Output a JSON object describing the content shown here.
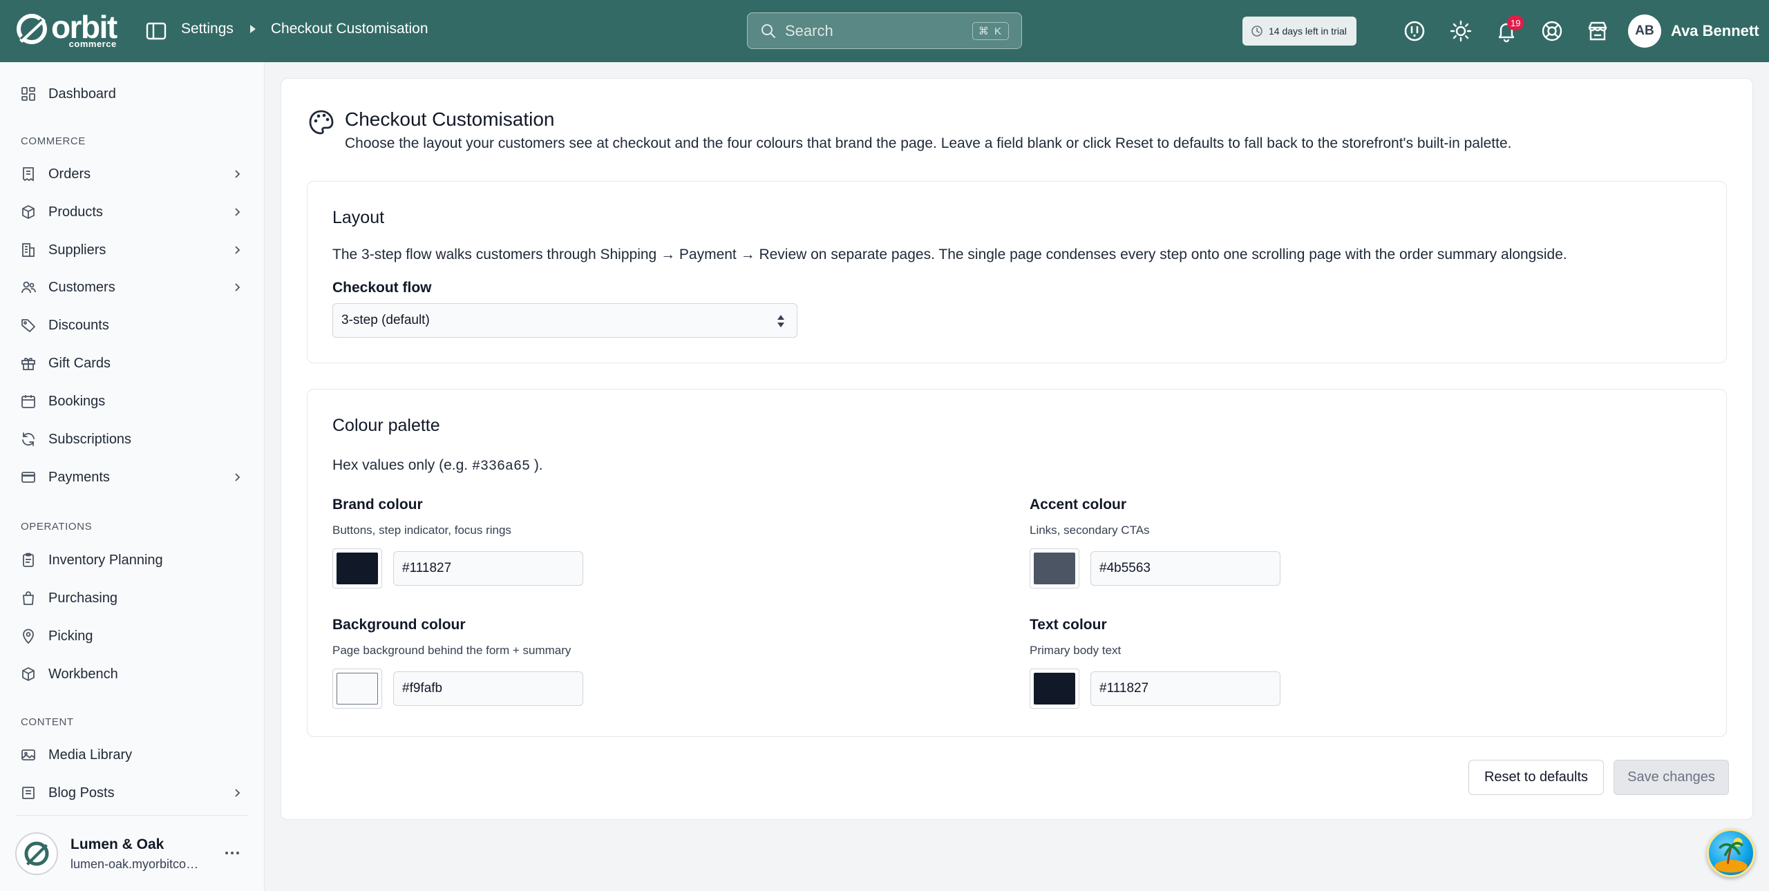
{
  "topbar": {
    "brand_name": "orbit",
    "brand_sub": "commerce",
    "breadcrumb": [
      "Settings",
      "Checkout Customisation"
    ],
    "search_placeholder": "Search",
    "search_shortcut": "⌘ K",
    "trial_text": "14 days left in trial",
    "notification_count": "19",
    "user_initials": "AB",
    "user_name": "Ava Bennett",
    "bar_color": "#336a65"
  },
  "sidebar": {
    "dashboard": "Dashboard",
    "section_commerce": "COMMERCE",
    "orders": "Orders",
    "products": "Products",
    "suppliers": "Suppliers",
    "customers": "Customers",
    "discounts": "Discounts",
    "gift_cards": "Gift Cards",
    "bookings": "Bookings",
    "subscriptions": "Subscriptions",
    "payments": "Payments",
    "section_operations": "OPERATIONS",
    "inventory_planning": "Inventory Planning",
    "purchasing": "Purchasing",
    "picking": "Picking",
    "workbench": "Workbench",
    "section_content": "CONTENT",
    "media_library": "Media Library",
    "blog_posts": "Blog Posts",
    "store_name": "Lumen & Oak",
    "store_url": "lumen-oak.myorbitcommerce.com"
  },
  "page": {
    "title": "Checkout Customisation",
    "description": "Choose the layout your customers see at checkout and the four colours that brand the page. Leave a field blank or click Reset to defaults to fall back to the storefront's built-in palette."
  },
  "layout_panel": {
    "title": "Layout",
    "text": "The 3-step flow walks customers through Shipping → Payment → Review on separate pages. The single page condenses every step onto one scrolling page with the order summary alongside.",
    "flow_label": "Checkout flow",
    "flow_value": "3-step (default)"
  },
  "palette_panel": {
    "title": "Colour palette",
    "hint_prefix": "Hex values only (e.g.",
    "hint_code": "#336a65",
    "hint_suffix": ").",
    "brand": {
      "label": "Brand colour",
      "help": "Buttons, step indicator, focus rings",
      "value": "#111827"
    },
    "accent": {
      "label": "Accent colour",
      "help": "Links, secondary CTAs",
      "value": "#4b5563"
    },
    "background": {
      "label": "Background colour",
      "help": "Page background behind the form + summary",
      "value": "#f9fafb"
    },
    "text": {
      "label": "Text colour",
      "help": "Primary body text",
      "value": "#111827"
    }
  },
  "actions": {
    "reset": "Reset to defaults",
    "save": "Save changes"
  }
}
